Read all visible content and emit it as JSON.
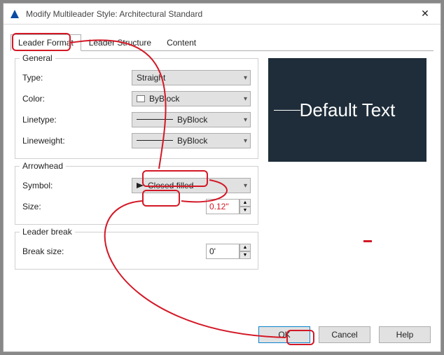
{
  "window": {
    "title": "Modify Multileader Style: Architectural Standard",
    "close": "✕"
  },
  "tabs": {
    "t1": "Leader Format",
    "t2": "Leader Structure",
    "t3": "Content"
  },
  "group_general": {
    "title": "General",
    "type_label": "Type:",
    "type_value": "Straight",
    "color_label": "Color:",
    "color_value": "ByBlock",
    "linetype_label": "Linetype:",
    "linetype_value": "ByBlock",
    "lineweight_label": "Lineweight:",
    "lineweight_value": "ByBlock"
  },
  "group_arrow": {
    "title": "Arrowhead",
    "symbol_label": "Symbol:",
    "symbol_value": "Closed filled",
    "size_label": "Size:",
    "size_value": "0.12\""
  },
  "group_break": {
    "title": "Leader break",
    "size_label": "Break size:",
    "size_value": "0'"
  },
  "preview_text": "Default Text",
  "buttons": {
    "ok": "OK",
    "cancel": "Cancel",
    "help": "Help"
  }
}
